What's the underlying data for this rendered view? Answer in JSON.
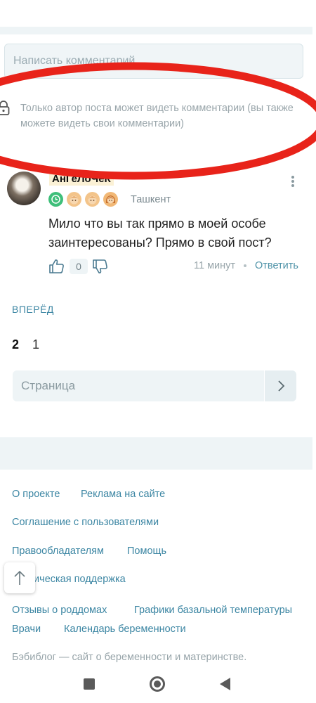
{
  "comment_form": {
    "placeholder": "Написать комментарий"
  },
  "notice": {
    "icon": "lock-icon",
    "text": "Только автор поста может видеть комментарии (вы также можете видеть свои комментарии)"
  },
  "annotation": {
    "color": "#e8231a"
  },
  "comment": {
    "username": "АнГеЛоЧеК",
    "city": "Ташкент",
    "badges": [
      "clock-badge-icon",
      "boy-badge-icon",
      "boy-badge-icon",
      "girl-badge-icon"
    ],
    "text": "Мило что вы так прямо в моей особе заинтересованы? Прямо в свой пост?",
    "likes": "0",
    "time": "11 минут",
    "reply_label": "Ответить"
  },
  "pagination": {
    "forward_label": "ВПЕРЁД",
    "current_page": "2",
    "other_page": "1",
    "page_input_placeholder": "Страница"
  },
  "footer": {
    "links": {
      "about": "О проекте",
      "ads": "Реклама на сайте",
      "agreement": "Соглашение с пользователями",
      "rights": "Правообладателям",
      "help": "Помощь",
      "support": "Техническая поддержка",
      "reviews": "Отзывы о роддомах",
      "charts": "Графики базальной температуры",
      "doctors": "Врачи",
      "calendar": "Календарь беременности"
    },
    "note": "Бэбиблог — сайт о беременности и материнстве."
  },
  "colors": {
    "accent": "#3c86a3",
    "background": "#ffffff",
    "panel": "#eef4f6"
  }
}
